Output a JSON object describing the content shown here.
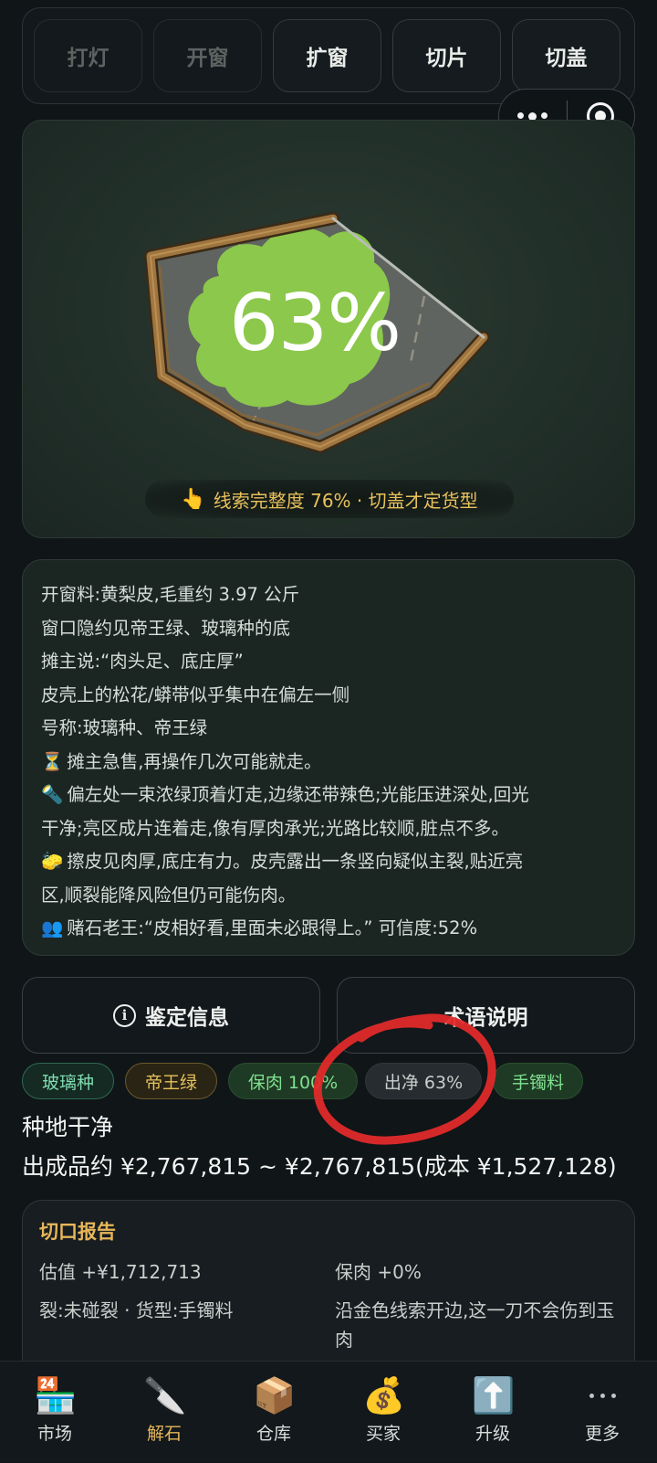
{
  "actions": [
    {
      "label": "打灯",
      "enabled": false
    },
    {
      "label": "开窗",
      "enabled": false
    },
    {
      "label": "扩窗",
      "enabled": true
    },
    {
      "label": "切片",
      "enabled": true
    },
    {
      "label": "切盖",
      "enabled": true
    }
  ],
  "capsule": {
    "more_icon": "more-dots-icon",
    "close_icon": "target-circle-icon"
  },
  "stone_view": {
    "window_percent": "63%",
    "hint_icon": "👆",
    "hint_text": "线索完整度 76% · 切盖才定货型"
  },
  "info": {
    "lines": [
      {
        "icon": "",
        "text": "开窗料:黄梨皮,毛重约 3.97 公斤"
      },
      {
        "icon": "",
        "text": "窗口隐约见帝王绿、玻璃种的底"
      },
      {
        "icon": "",
        "text": "摊主说:“肉头足、底庄厚”"
      },
      {
        "icon": "",
        "text": "皮壳上的松花/蟒带似乎集中在偏左一侧"
      },
      {
        "icon": "",
        "text": "号称:玻璃种、帝王绿"
      },
      {
        "icon": "⏳",
        "text": "摊主急售,再操作几次可能就走。"
      },
      {
        "icon": "🔦",
        "text": "偏左处一束浓绿顶着灯走,边缘还带辣色;光能压进深处,回光"
      },
      {
        "icon": "",
        "text": "干净;亮区成片连着走,像有厚肉承光;光路比较顺,脏点不多。"
      },
      {
        "icon": "🧽",
        "text": "擦皮见肉厚,底庄有力。皮壳露出一条竖向疑似主裂,贴近亮"
      },
      {
        "icon": "",
        "text": "区,顺裂能降风险但仍可能伤肉。"
      },
      {
        "icon": "👥",
        "text": "赌石老王:“皮相好看,里面未必跟得上。” 可信度:52%"
      }
    ]
  },
  "buttons": {
    "appraisal": "鉴定信息",
    "glossary": "术语说明"
  },
  "tags": [
    {
      "label": "玻璃种",
      "style": "green"
    },
    {
      "label": "帝王绿",
      "style": "gold"
    },
    {
      "label": "保肉 100%",
      "style": "lgreen"
    },
    {
      "label": "出净 63%",
      "style": "gray"
    },
    {
      "label": "手镯料",
      "style": "lgreen"
    }
  ],
  "summary": {
    "quality": "种地干净",
    "yield": "出成品约 ¥2,767,815 ~ ¥2,767,815(成本 ¥1,527,128)"
  },
  "report": {
    "title": "切口报告",
    "valuation": "估值 +¥1,712,713",
    "keep_flesh": "保肉 +0%",
    "crack_type": "裂:未碰裂 · 货型:手镯料",
    "advice": "沿金色线索开边,这一刀不会伤到玉肉"
  },
  "nav": [
    {
      "label": "市场",
      "icon": "🏪",
      "active": false
    },
    {
      "label": "解石",
      "icon": "🔪",
      "active": true
    },
    {
      "label": "仓库",
      "icon": "📦",
      "active": false
    },
    {
      "label": "买家",
      "icon": "💰",
      "active": false
    },
    {
      "label": "升级",
      "icon": "⬆️",
      "active": false
    },
    {
      "label": "更多",
      "icon": "···",
      "active": false
    }
  ],
  "colors": {
    "background": "#101518",
    "accent_gold": "#e6b65a",
    "jade_green": "#8cc84b",
    "annotation_red": "#e02a2a"
  }
}
